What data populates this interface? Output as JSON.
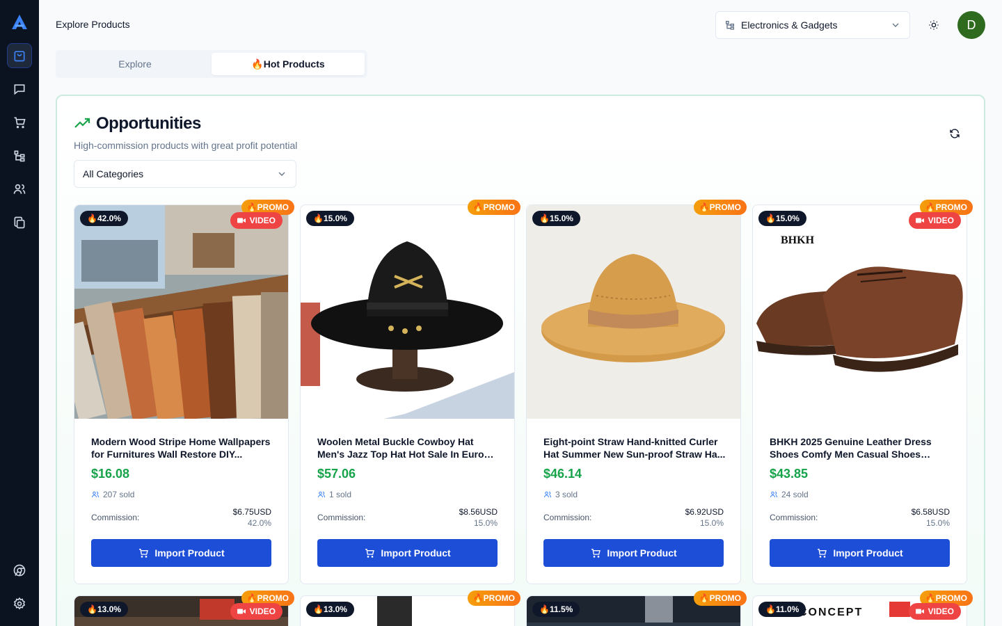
{
  "header": {
    "page_title": "Explore Products",
    "category_select": "Electronics & Gadgets",
    "avatar_initial": "D"
  },
  "tabs": [
    {
      "label": "Explore",
      "active": false
    },
    {
      "label": "🔥Hot Products",
      "active": true
    }
  ],
  "sidebar": {
    "items": [
      "products-icon",
      "chat-icon",
      "cart-icon",
      "hierarchy-icon",
      "users-icon",
      "copy-icon"
    ],
    "bottom": [
      "chrome-icon",
      "gear-icon"
    ]
  },
  "panel": {
    "title": "Opportunities",
    "subtitle": "High-commission products with great profit potential",
    "filter": "All Categories"
  },
  "labels": {
    "commission": "Commission:",
    "import": "Import Product",
    "promo": "🔥PROMO",
    "video": "VIDEO"
  },
  "products": [
    {
      "badge": "🔥42.0%",
      "promo": true,
      "video": true,
      "title": "Modern Wood Stripe Home Wallpapers for Furnitures Wall Restore DIY...",
      "price": "$16.08",
      "sold": "207 sold",
      "commission": "$6.75USD",
      "commission_pct": "42.0%"
    },
    {
      "badge": "🔥15.0%",
      "promo": true,
      "video": false,
      "title": "Woolen Metal Buckle Cowboy Hat Men's Jazz Top Hat Hot Sale In Europe And...",
      "price": "$57.06",
      "sold": "1 sold",
      "commission": "$8.56USD",
      "commission_pct": "15.0%"
    },
    {
      "badge": "🔥15.0%",
      "promo": true,
      "video": false,
      "title": "Eight-point Straw Hand-knitted Curler Hat Summer New Sun-proof Straw Ha...",
      "price": "$46.14",
      "sold": "3 sold",
      "commission": "$6.92USD",
      "commission_pct": "15.0%"
    },
    {
      "badge": "🔥15.0%",
      "promo": true,
      "video": true,
      "title": "BHKH 2025 Genuine Leather Dress Shoes Comfy Men Casual Shoes Smar...",
      "price": "$43.85",
      "sold": "24 sold",
      "commission": "$6.58USD",
      "commission_pct": "15.0%",
      "brand": "BHKH"
    }
  ],
  "products_row2": [
    {
      "badge": "🔥13.0%",
      "promo": true,
      "video": true
    },
    {
      "badge": "🔥13.0%",
      "promo": true,
      "video": false
    },
    {
      "badge": "🔥11.5%",
      "promo": true,
      "video": false
    },
    {
      "badge": "🔥11.0%",
      "promo": true,
      "video": true,
      "brand_text": "CONCEPT"
    }
  ],
  "colors": {
    "accent": "#1d4ed8",
    "price": "#16a34a",
    "promo": "#f97316",
    "video": "#ef4444"
  }
}
